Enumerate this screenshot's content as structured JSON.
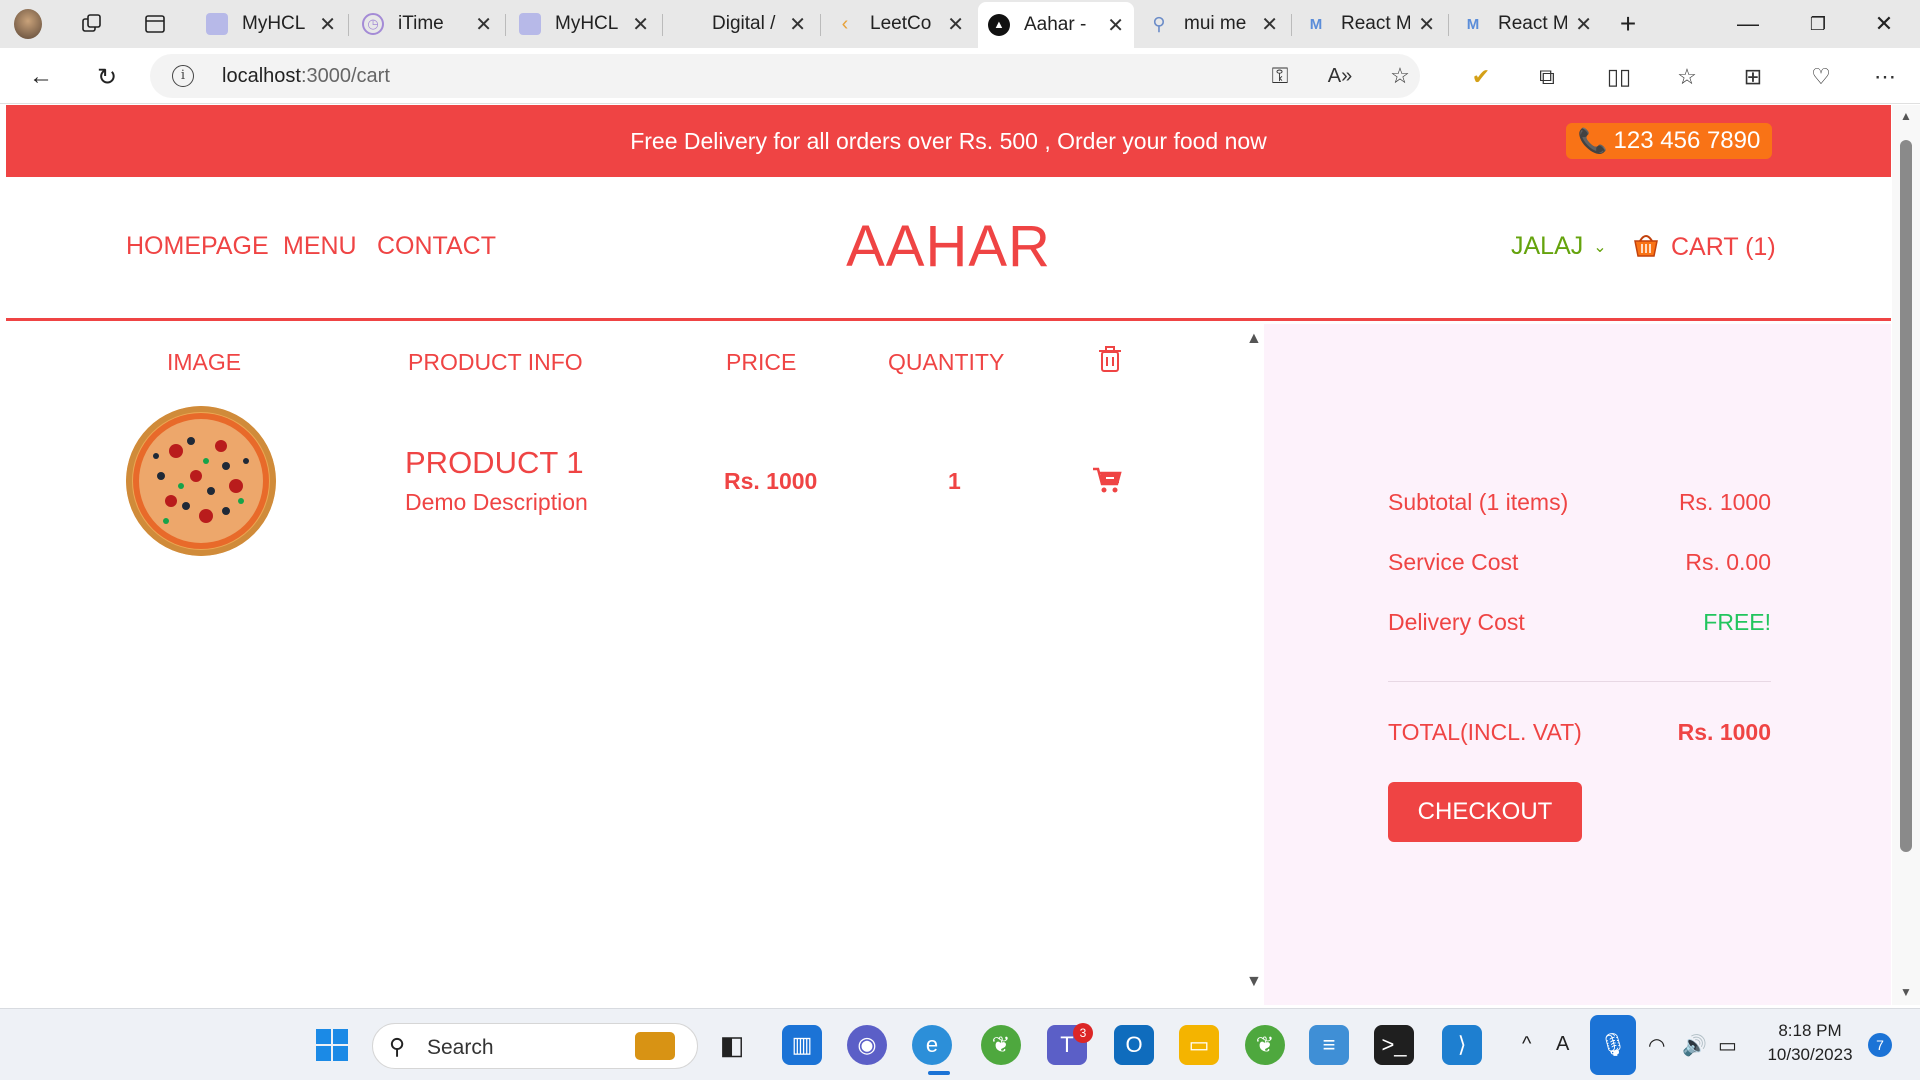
{
  "browser": {
    "tabs": [
      {
        "label": "MyHCL",
        "favicon": "myhcl-icon"
      },
      {
        "label": "iTime",
        "favicon": "clock-icon"
      },
      {
        "label": "MyHCL",
        "favicon": "myhcl-icon"
      },
      {
        "label": "Digital /",
        "favicon": "blank"
      },
      {
        "label": "LeetCo",
        "favicon": "leetcode-icon"
      },
      {
        "label": "Aahar -",
        "favicon": "aahar-icon",
        "active": true
      },
      {
        "label": "mui me",
        "favicon": "search-icon"
      },
      {
        "label": "React M",
        "favicon": "mui-icon"
      },
      {
        "label": "React M",
        "favicon": "mui-icon"
      }
    ],
    "url_host": "localhost",
    "url_path": ":3000/cart"
  },
  "promo": {
    "text": "Free Delivery for all orders over Rs. 500 , Order your food now",
    "phone": "123 456 7890"
  },
  "nav": {
    "links": [
      "HOMEPAGE",
      "MENU",
      "CONTACT"
    ],
    "logo": "AAHAR",
    "user": "JALAJ",
    "cart": "CART (1)"
  },
  "cart_table": {
    "headers": {
      "image": "IMAGE",
      "product_info": "PRODUCT INFO",
      "price": "PRICE",
      "quantity": "QUANTITY"
    },
    "rows": [
      {
        "name": "PRODUCT 1",
        "description": "Demo Description",
        "price": "Rs. 1000",
        "quantity": "1"
      }
    ]
  },
  "summary": {
    "subtotal_label": "Subtotal (1 items)",
    "subtotal_value": "Rs. 1000",
    "service_label": "Service Cost",
    "service_value": "Rs. 0.00",
    "delivery_label": "Delivery Cost",
    "delivery_value": "FREE!",
    "total_label": "TOTAL(INCL. VAT)",
    "total_value": "Rs. 1000",
    "checkout": "CHECKOUT"
  },
  "taskbar": {
    "search": "Search",
    "time": "8:18 PM",
    "date": "10/30/2023",
    "teams_badge": "3",
    "notification_count": "7"
  },
  "colors": {
    "brand": "#ef4444",
    "accent_orange": "#f97316",
    "user_green": "#65a30d",
    "free_green": "#22c55e",
    "summary_bg": "#fdf2fb"
  }
}
